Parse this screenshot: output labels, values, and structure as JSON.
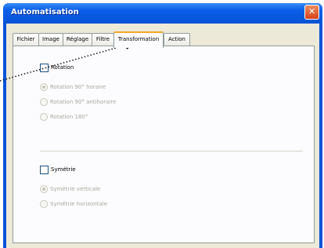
{
  "window": {
    "title": "Automatisation",
    "close_glyph": "✕"
  },
  "tabs": [
    {
      "label": "Fichier"
    },
    {
      "label": "Image"
    },
    {
      "label": "Réglage"
    },
    {
      "label": "Filtre"
    },
    {
      "label": "Transformation",
      "active": true
    },
    {
      "label": "Action"
    }
  ],
  "rotation": {
    "label": "Rotation",
    "checked": false,
    "options": [
      {
        "label": "Rotation 90° horaire",
        "selected": true
      },
      {
        "label": "Rotation 90° antihoraire",
        "selected": false
      },
      {
        "label": "Rotation 180°",
        "selected": false
      }
    ]
  },
  "symetrie": {
    "label": "Symétrie",
    "checked": false,
    "options": [
      {
        "label": "Symétrie verticale",
        "selected": true
      },
      {
        "label": "Symétrie horizontale",
        "selected": false
      }
    ]
  }
}
